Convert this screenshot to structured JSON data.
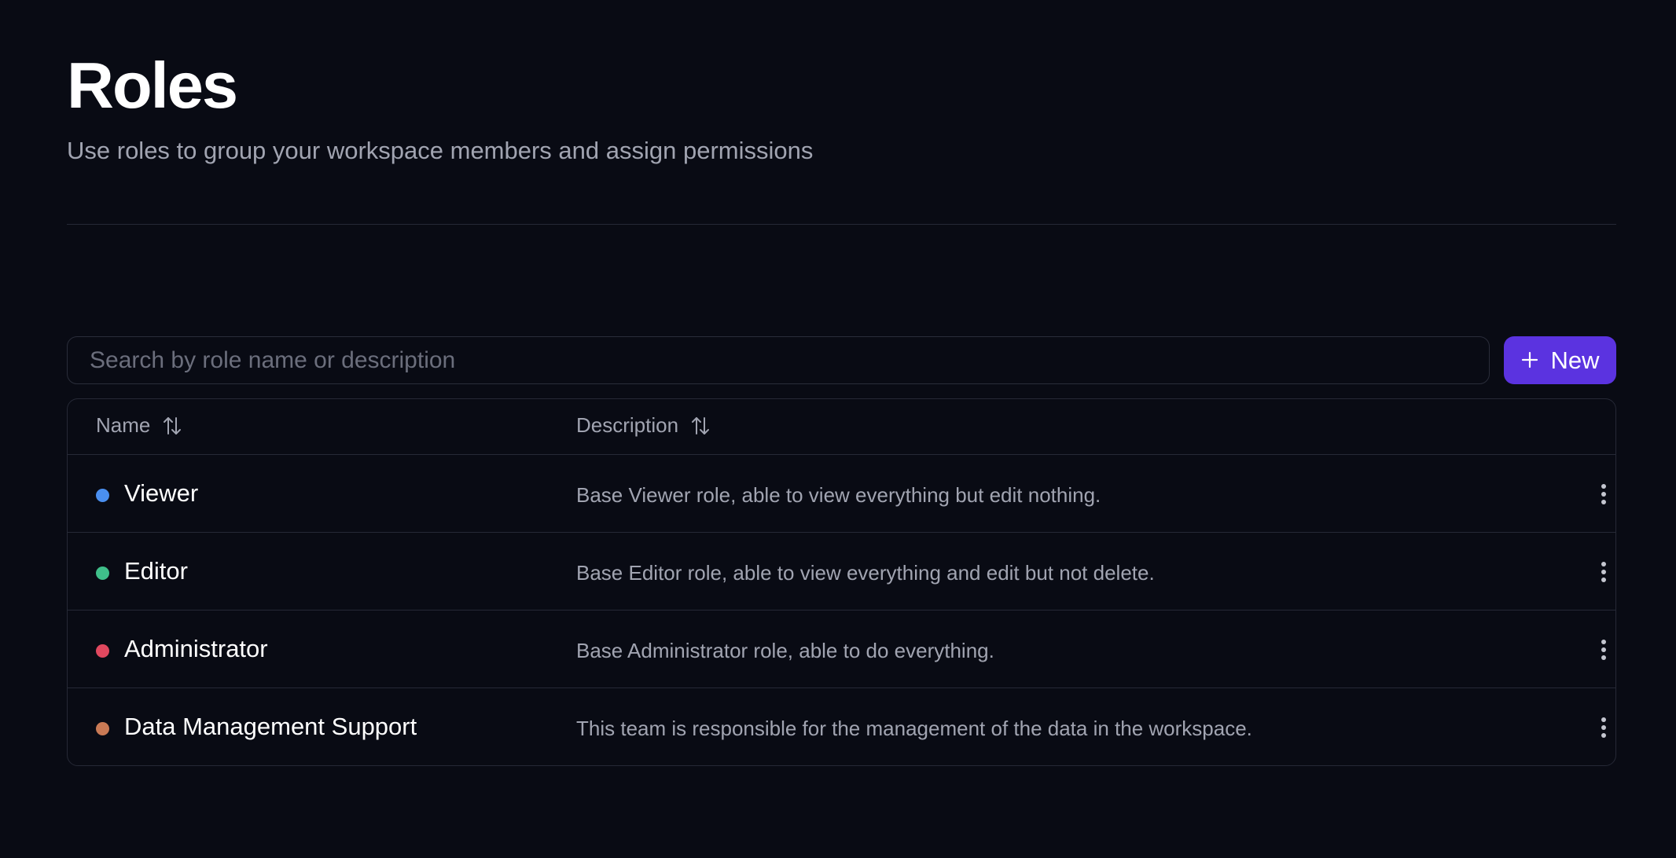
{
  "header": {
    "title": "Roles",
    "subtitle": "Use roles to group your workspace members and assign permissions"
  },
  "search": {
    "placeholder": "Search by role name or description",
    "value": ""
  },
  "new_button": {
    "label": "New",
    "icon": "plus-icon",
    "color": "#5b33e0"
  },
  "table": {
    "columns": [
      {
        "label": "Name",
        "icon": "sort-icon"
      },
      {
        "label": "Description",
        "icon": "sort-icon"
      }
    ],
    "rows": [
      {
        "name": "Viewer",
        "description": "Base Viewer role, able to view everything but edit nothing.",
        "color": "#4a8ff0",
        "menu_icon": "more-vertical-icon"
      },
      {
        "name": "Editor",
        "description": "Base Editor role, able to view everything and edit but not delete.",
        "color": "#3fbf8a",
        "menu_icon": "more-vertical-icon"
      },
      {
        "name": "Administrator",
        "description": "Base Administrator role, able to do everything.",
        "color": "#e0485f",
        "menu_icon": "more-vertical-icon"
      },
      {
        "name": "Data Management Support",
        "description": "This team is responsible for the management of the data in the workspace.",
        "color": "#c97a55",
        "menu_icon": "more-vertical-icon"
      }
    ]
  }
}
